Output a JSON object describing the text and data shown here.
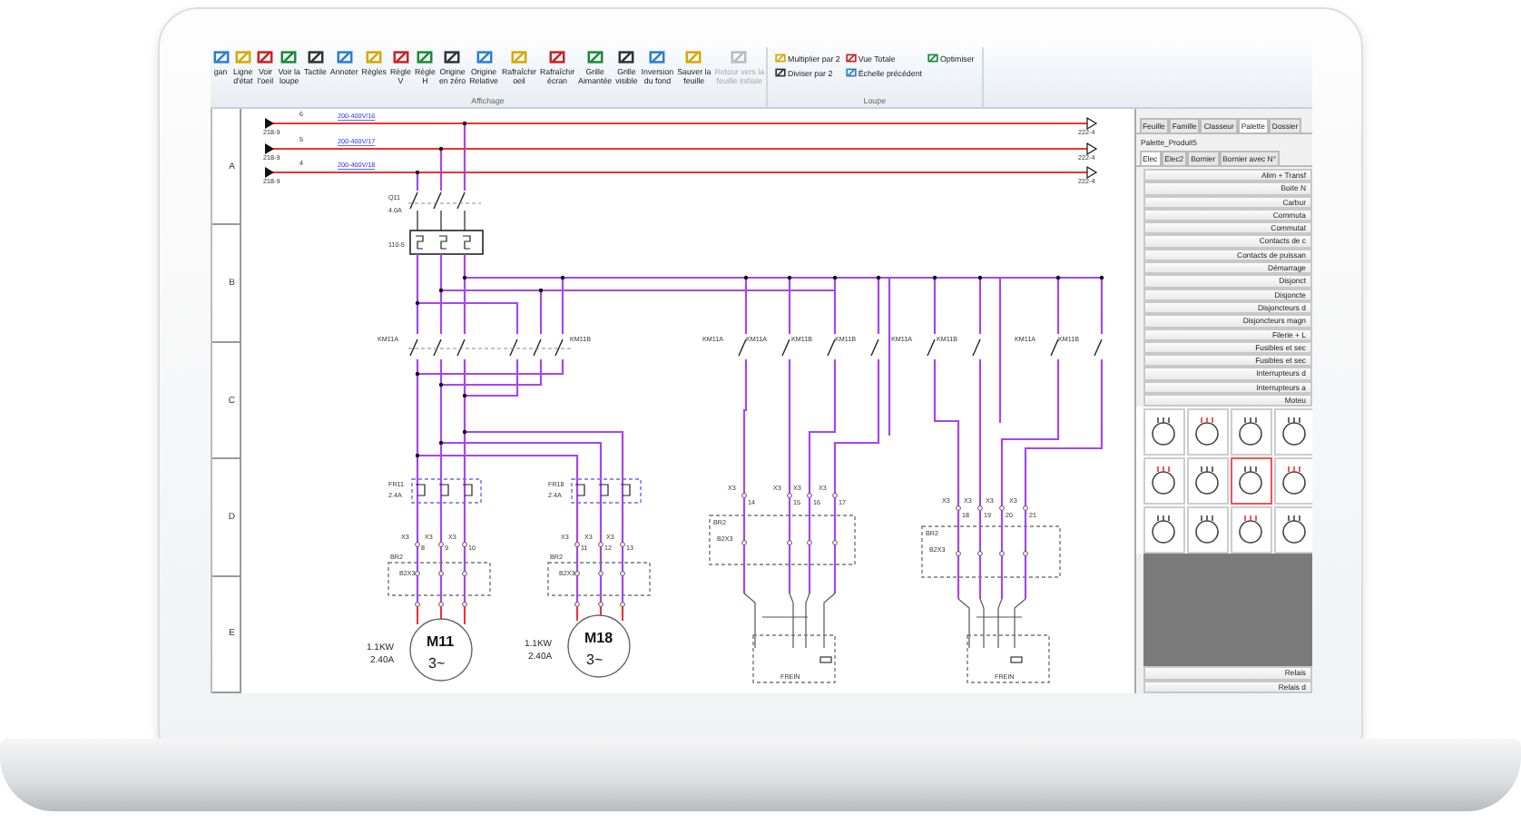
{
  "ribbon": {
    "groups": [
      {
        "label": "Affichage",
        "kind": "large",
        "buttons": [
          {
            "label": "gan",
            "disabled": false
          },
          {
            "label": "Ligne\nd'état",
            "disabled": false
          },
          {
            "label": "Voir\nl'oeil",
            "disabled": false
          },
          {
            "label": "Voir la\nloupe",
            "disabled": false
          },
          {
            "label": "Tactile",
            "disabled": false
          },
          {
            "label": "Annoter",
            "disabled": false
          },
          {
            "label": "Règles",
            "disabled": false
          },
          {
            "label": "Règle\nV",
            "disabled": false
          },
          {
            "label": "Règle\nH",
            "disabled": false
          },
          {
            "label": "Origine\nen zéro",
            "disabled": false
          },
          {
            "label": "Origine\nRelative",
            "disabled": false
          },
          {
            "label": "Rafraîchir\noeil",
            "disabled": false
          },
          {
            "label": "Rafraîchir\nécran",
            "disabled": false
          },
          {
            "label": "Grille\nAimantée",
            "disabled": false
          },
          {
            "label": "Grille\nvisible",
            "disabled": false
          },
          {
            "label": "Inversion\ndu fond",
            "disabled": false
          },
          {
            "label": "Sauver la\nfeuille",
            "disabled": false
          },
          {
            "label": "Retour vers la\nfeuille initiale",
            "disabled": true
          }
        ]
      },
      {
        "label": "Loupe",
        "kind": "small",
        "buttons": [
          {
            "label": "Multiplier par 2",
            "disabled": false
          },
          {
            "label": "Vue Totale",
            "disabled": false
          },
          {
            "label": "Optimiser",
            "disabled": false
          },
          {
            "label": "Diviser par 2",
            "disabled": false
          },
          {
            "label": "Échelle précédent",
            "disabled": false
          }
        ]
      }
    ]
  },
  "schematic": {
    "ruler_rows": [
      "A",
      "B",
      "C",
      "D",
      "E"
    ],
    "supply_lines": [
      {
        "number": "6",
        "voltage": "200-400V/16",
        "source": "218-9",
        "target": "222-4"
      },
      {
        "number": "5",
        "voltage": "200-400V/17",
        "source": "218-9",
        "target": "222-4"
      },
      {
        "number": "4",
        "voltage": "200-400V/18",
        "source": "218-9",
        "target": "222-4"
      }
    ],
    "breaker": {
      "name": "Q11",
      "rating": "4.0A",
      "reference": "110-5"
    },
    "main_contactors": [
      "KM11A",
      "KM11B"
    ],
    "aux_contacts": [
      "KM11A",
      "KM11A",
      "KM11B",
      "KM11B",
      "KM11A",
      "KM11B",
      "KM11A",
      "KM11B"
    ],
    "motor_circuits": [
      {
        "relay": "FR11",
        "relay_rating": "2.4A",
        "terminals": [
          {
            "strip": "X3",
            "number": "8"
          },
          {
            "strip": "X3",
            "number": "9"
          },
          {
            "strip": "X3",
            "number": "10"
          }
        ],
        "connector": "BR2",
        "plug": "B2X3",
        "motor": {
          "name": "M11",
          "symbol": "3~",
          "power": "1.1KW",
          "current": "2.40A"
        }
      },
      {
        "relay": "FR18",
        "relay_rating": "2.4A",
        "terminals": [
          {
            "strip": "X3",
            "number": "11"
          },
          {
            "strip": "X3",
            "number": "12"
          },
          {
            "strip": "X3",
            "number": "13"
          }
        ],
        "connector": "BR2",
        "plug": "B2X3",
        "motor": {
          "name": "M18",
          "symbol": "3~",
          "power": "1.1KW",
          "current": "2.40A"
        }
      }
    ],
    "brake_circuits": [
      {
        "terminals": [
          {
            "strip": "X3",
            "number": "14"
          },
          {
            "strip": "X3",
            "number": "15"
          },
          {
            "strip": "X3",
            "number": "16"
          },
          {
            "strip": "X3",
            "number": "17"
          }
        ],
        "connector": "BR2",
        "plug": "B2X3",
        "label": "FREIN"
      },
      {
        "terminals": [
          {
            "strip": "X3",
            "number": "18"
          },
          {
            "strip": "X3",
            "number": "19"
          },
          {
            "strip": "X3",
            "number": "20"
          },
          {
            "strip": "X3",
            "number": "21"
          }
        ],
        "connector": "BR2",
        "plug": "B2X3",
        "label": "FREIN"
      }
    ]
  },
  "panel": {
    "tabs": [
      {
        "label": "Feuille",
        "selected": false
      },
      {
        "label": "Famille",
        "selected": false
      },
      {
        "label": "Classeur",
        "selected": false
      },
      {
        "label": "Palette",
        "selected": true
      },
      {
        "label": "Dossier",
        "selected": false
      }
    ],
    "title": "Palette_Produit5",
    "subtabs": [
      {
        "label": "Elec",
        "selected": true
      },
      {
        "label": "Elec2",
        "selected": false
      },
      {
        "label": "Bornier",
        "selected": false
      },
      {
        "label": "Bornier avec N°",
        "selected": false
      }
    ],
    "categories": [
      "Alim + Transf",
      "Boite N",
      "Carbur",
      "Commuta",
      "Commutat",
      "Contacts de c",
      "Contacts de puissan",
      "Démarrage",
      "Disjonct",
      "Disjoncte",
      "Disjoncteurs d",
      "Disjoncteurs magn",
      "Filerie + L",
      "Fusibles et sec",
      "Fusibles et sec",
      "Interrupteurs d",
      "Interrupteurs a",
      "Moteu"
    ],
    "symbols": [
      {
        "selected": false
      },
      {
        "selected": false
      },
      {
        "selected": false
      },
      {
        "selected": false
      },
      {
        "selected": false
      },
      {
        "selected": false
      },
      {
        "selected": true
      },
      {
        "selected": false
      },
      {
        "selected": false
      },
      {
        "selected": false
      },
      {
        "selected": false
      },
      {
        "selected": false
      }
    ],
    "bottom_categories": [
      "Relais",
      "Relais d"
    ]
  }
}
